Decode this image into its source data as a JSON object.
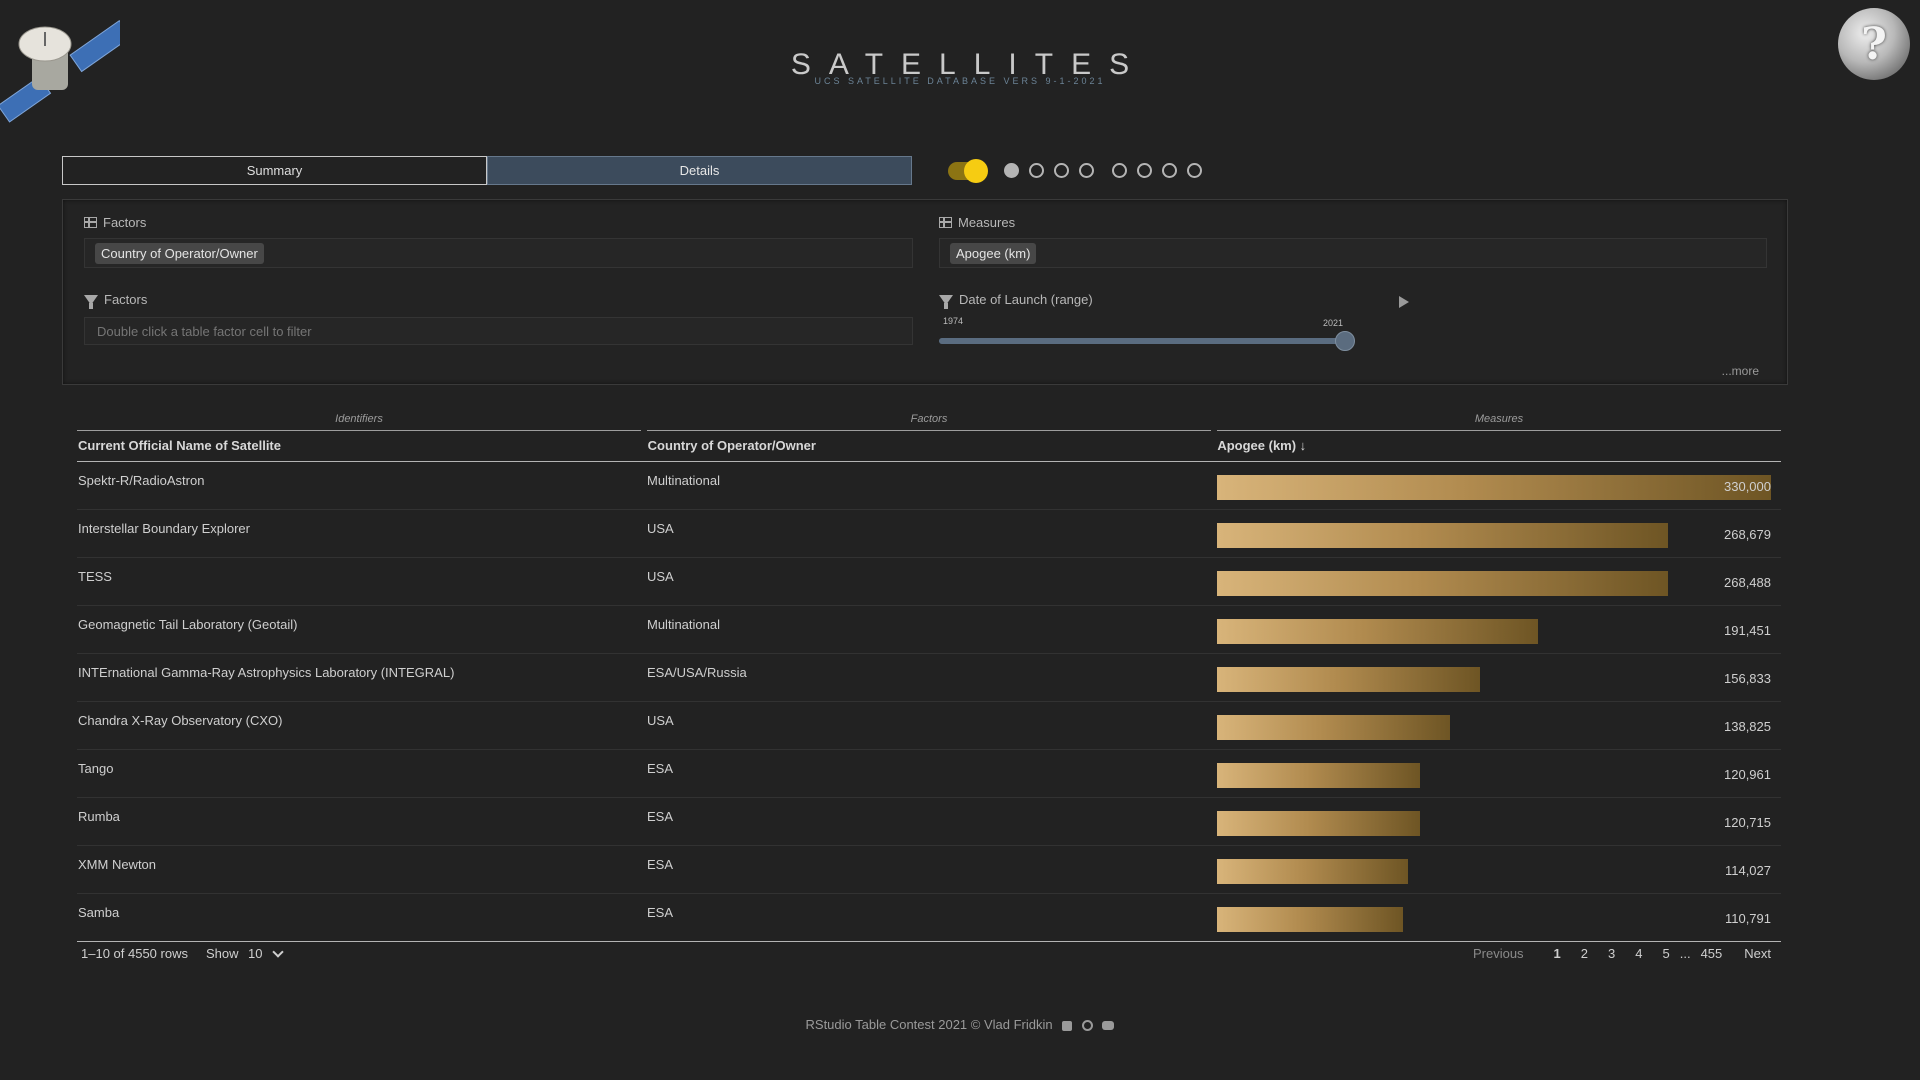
{
  "header": {
    "title": "SATELLITES",
    "subtitle": "UCS SATELLITE DATABASE VERS 9-1-2021",
    "help_label": "?"
  },
  "tabs": [
    {
      "label": "Summary",
      "active": false
    },
    {
      "label": "Details",
      "active": true
    }
  ],
  "panel": {
    "factors_label": "Factors",
    "factor_chip": "Country of Operator/Owner",
    "measures_label": "Measures",
    "measure_chip": "Apogee (km)",
    "filter_label": "Factors",
    "filter_placeholder": "Double click a table factor cell to filter",
    "date_label": "Date of Launch (range)",
    "date_min": "1974",
    "date_max": "2021",
    "more_label": "...more"
  },
  "table": {
    "groups": [
      "Identifiers",
      "Factors",
      "Measures"
    ],
    "columns": [
      "Current Official Name of Satellite",
      "Country of Operator/Owner",
      "Apogee (km) ↓"
    ],
    "max_value": 330000,
    "rows": [
      {
        "name": "Spektr-R/RadioAstron",
        "country": "Multinational",
        "apogee": 330000,
        "apogee_label": "330,000"
      },
      {
        "name": "Interstellar Boundary Explorer",
        "country": "USA",
        "apogee": 268679,
        "apogee_label": "268,679"
      },
      {
        "name": "TESS",
        "country": "USA",
        "apogee": 268488,
        "apogee_label": "268,488"
      },
      {
        "name": "Geomagnetic Tail Laboratory (Geotail)",
        "country": "Multinational",
        "apogee": 191451,
        "apogee_label": "191,451"
      },
      {
        "name": "INTErnational Gamma-Ray Astrophysics Laboratory (INTEGRAL)",
        "country": "ESA/USA/Russia",
        "apogee": 156833,
        "apogee_label": "156,833"
      },
      {
        "name": "Chandra X-Ray Observatory (CXO)",
        "country": "USA",
        "apogee": 138825,
        "apogee_label": "138,825"
      },
      {
        "name": "Tango",
        "country": "ESA",
        "apogee": 120961,
        "apogee_label": "120,961"
      },
      {
        "name": "Rumba",
        "country": "ESA",
        "apogee": 120715,
        "apogee_label": "120,715"
      },
      {
        "name": "XMM Newton",
        "country": "ESA",
        "apogee": 114027,
        "apogee_label": "114,027"
      },
      {
        "name": "Samba",
        "country": "ESA",
        "apogee": 110791,
        "apogee_label": "110,791"
      }
    ]
  },
  "pagination": {
    "row_info": "1–10 of 4550 rows",
    "show_label": "Show",
    "page_size": "10",
    "previous": "Previous",
    "pages": [
      "1",
      "2",
      "3",
      "4",
      "5"
    ],
    "ellipsis": "...",
    "last_page": "455",
    "next": "Next"
  },
  "footer": {
    "credit": "RStudio Table Contest 2021 © Vlad Fridkin"
  },
  "colors": {
    "background": "#222222",
    "accent_toggle": "#f6cc12",
    "details_tab": "#3c4b5c",
    "bar_start": "#d8b47a",
    "bar_end": "#6e5524"
  }
}
